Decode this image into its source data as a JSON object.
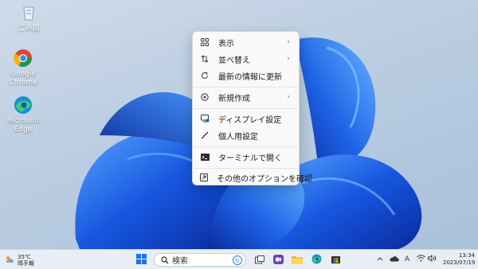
{
  "desktop": {
    "icons": [
      {
        "label": "ごみ箱",
        "icon": "recycle-bin-icon"
      },
      {
        "label": "Google Chrome",
        "icon": "chrome-icon"
      },
      {
        "label": "Microsoft Edge",
        "icon": "edge-icon"
      }
    ]
  },
  "context_menu": {
    "items": [
      {
        "label": "表示",
        "icon": "view-grid-icon",
        "has_submenu": true
      },
      {
        "label": "並べ替え",
        "icon": "sort-icon",
        "has_submenu": true
      },
      {
        "label": "最新の情報に更新",
        "icon": "refresh-icon",
        "has_submenu": false
      },
      {
        "label": "新規作成",
        "icon": "new-plus-icon",
        "has_submenu": true
      },
      {
        "label": "ディスプレイ設定",
        "icon": "display-settings-icon",
        "has_submenu": false
      },
      {
        "label": "個人用設定",
        "icon": "personalize-brush-icon",
        "has_submenu": false
      },
      {
        "label": "ターミナルで開く",
        "icon": "terminal-icon",
        "has_submenu": false
      },
      {
        "label": "その他のオプションを確認",
        "icon": "more-options-icon",
        "has_submenu": false
      }
    ],
    "submenu_arrow": "›"
  },
  "taskbar": {
    "weather": {
      "temp": "35℃",
      "condition": "晴手報"
    },
    "search_placeholder": "検索",
    "apps": [
      "start-icon",
      "search-icon",
      "task-view-icon",
      "chat-icon",
      "file-explorer-icon",
      "edge-icon",
      "store-icon"
    ],
    "tray": {
      "ime": "A"
    },
    "clock": {
      "time": "13:34",
      "date": "2023/07/19"
    }
  },
  "colors": {
    "wallpaper_bg": "#bccfe3",
    "bloom_dark": "#0a2fa8",
    "bloom_mid": "#1652d6",
    "bloom_light": "#3a8bf2",
    "accent": "#0067c0"
  }
}
